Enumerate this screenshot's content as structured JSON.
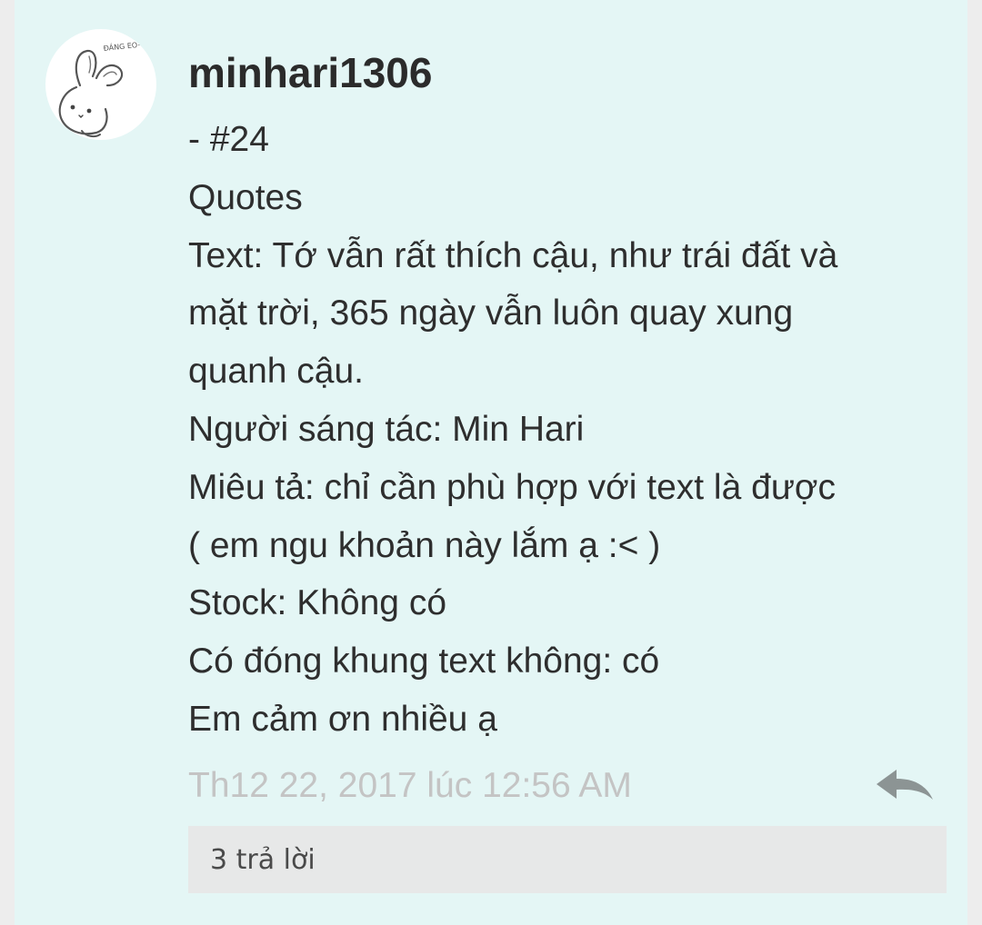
{
  "post": {
    "author": {
      "username": "minhari1306",
      "avatar_icon": "bunny-avatar-icon",
      "avatar_caption": "ĐÁNG EO~"
    },
    "lines": [
      "- #24",
      "Quotes",
      "Text: Tớ vẫn rất thích cậu, như trái đất và",
      "mặt trời, 365 ngày vẫn luôn quay xung",
      "quanh cậu.",
      "Người sáng tác: Min Hari",
      "Miêu tả: chỉ cần phù hợp với text là được",
      "( em ngu khoản này lắm ạ :< )",
      "Stock: Không có",
      "Có đóng khung text không: có",
      "Em cảm ơn nhiều ạ"
    ],
    "timestamp": "Th12 22, 2017 lúc 12:56 AM",
    "reply_icon": "reply-arrow-icon",
    "replies_label": "3 trả lời"
  },
  "colors": {
    "card_background": "#e4f6f5",
    "page_background": "#ededed",
    "text": "#2e2e2e",
    "timestamp": "#c4c4c4",
    "reply_icon": "#8c9494",
    "replies_box": "#e7e8e8"
  }
}
